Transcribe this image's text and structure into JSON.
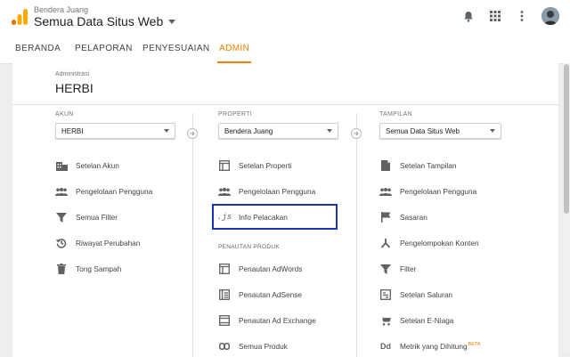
{
  "header": {
    "subtitle": "Bendera Juang",
    "property": "Semua Data Situs Web",
    "icons": [
      "notifications-icon",
      "apps-grid-icon",
      "more-vert-icon",
      "avatar"
    ]
  },
  "nav": {
    "tabs": [
      {
        "label": "BERANDA",
        "active": false
      },
      {
        "label": "PELAPORAN",
        "active": false
      },
      {
        "label": "PENYESUAIAN",
        "active": false
      },
      {
        "label": "ADMIN",
        "active": true
      }
    ]
  },
  "admin": {
    "small_label": "Administrasi",
    "account_title": "HERBI"
  },
  "account": {
    "label": "AKUN",
    "selected": "HERBI",
    "items": [
      {
        "label": "Setelan Akun",
        "icon": "building-icon"
      },
      {
        "label": "Pengelolaan Pengguna",
        "icon": "users-icon"
      },
      {
        "label": "Semua Filter",
        "icon": "filter-icon"
      },
      {
        "label": "Riwayat Perubahan",
        "icon": "history-icon"
      },
      {
        "label": "Tong Sampah",
        "icon": "trash-icon"
      }
    ]
  },
  "property": {
    "label": "PROPERTI",
    "selected": "Bendera Juang",
    "items": [
      {
        "label": "Setelan Properti",
        "icon": "window-icon"
      },
      {
        "label": "Pengelolaan Pengguna",
        "icon": "users-icon"
      },
      {
        "label": "Info Pelacakan",
        "icon": "js-icon",
        "selected": true
      }
    ],
    "section_label": "PENAUTAN PRODUK",
    "product_items": [
      {
        "label": "Penautan AdWords",
        "icon": "window-icon"
      },
      {
        "label": "Penautan AdSense",
        "icon": "list-window-icon"
      },
      {
        "label": "Penautan Ad Exchange",
        "icon": "window-icon"
      },
      {
        "label": "Semua Produk",
        "icon": "link-icon"
      }
    ]
  },
  "view": {
    "label": "TAMPILAN",
    "selected": "Semua Data Situs Web",
    "items": [
      {
        "label": "Setelan Tampilan",
        "icon": "document-icon"
      },
      {
        "label": "Pengelolaan Pengguna",
        "icon": "users-icon"
      },
      {
        "label": "Sasaran",
        "icon": "flag-icon"
      },
      {
        "label": "Pengelompokan Konten",
        "icon": "hierarchy-icon"
      },
      {
        "label": "Filter",
        "icon": "filter-icon"
      },
      {
        "label": "Setelan Saluran",
        "icon": "channel-icon"
      },
      {
        "label": "Setelan E-Niaga",
        "icon": "cart-icon"
      },
      {
        "label": "Metrik yang Dihitung",
        "icon": "dd-icon",
        "badge": "BETA"
      }
    ]
  },
  "colors": {
    "accent": "#f57c00",
    "highlight": "#1a35b8",
    "logo_bars": [
      "#f9ab00",
      "#e37400"
    ]
  }
}
